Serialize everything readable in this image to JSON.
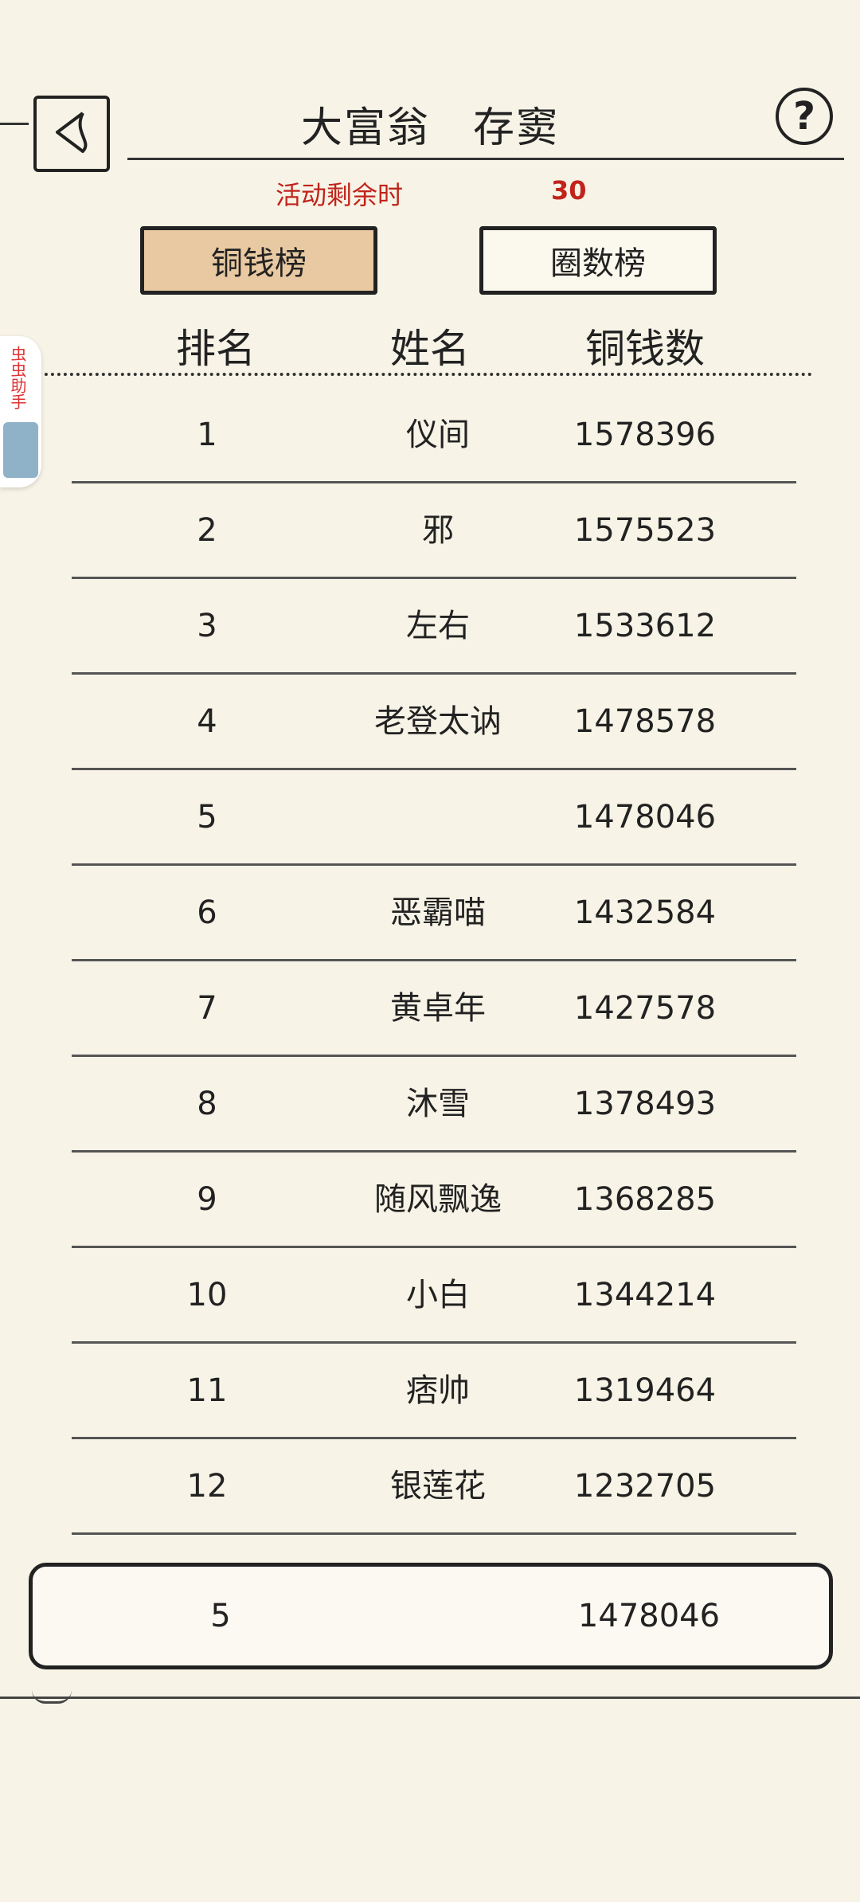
{
  "header": {
    "title": "大富翁　存窦",
    "help_label": "?"
  },
  "countdown": {
    "label": "活动剩余时",
    "value": "30"
  },
  "tabs": [
    {
      "label": "铜钱榜",
      "active": true
    },
    {
      "label": "圈数榜",
      "active": false
    }
  ],
  "columns": {
    "rank": "排名",
    "name": "姓名",
    "coins": "铜钱数"
  },
  "rows": [
    {
      "rank": "1",
      "name": "仪间",
      "coins": "1578396"
    },
    {
      "rank": "2",
      "name": "邪",
      "coins": "1575523"
    },
    {
      "rank": "3",
      "name": "左右",
      "coins": "1533612"
    },
    {
      "rank": "4",
      "name": "老登太讷",
      "coins": "1478578"
    },
    {
      "rank": "5",
      "name": "",
      "coins": "1478046"
    },
    {
      "rank": "6",
      "name": "恶霸喵",
      "coins": "1432584"
    },
    {
      "rank": "7",
      "name": "黄卓年",
      "coins": "1427578"
    },
    {
      "rank": "8",
      "name": "沐雪",
      "coins": "1378493"
    },
    {
      "rank": "9",
      "name": "随风飘逸",
      "coins": "1368285"
    },
    {
      "rank": "10",
      "name": "小白",
      "coins": "1344214"
    },
    {
      "rank": "11",
      "name": "痞帅",
      "coins": "1319464"
    },
    {
      "rank": "12",
      "name": "银莲花",
      "coins": "1232705"
    }
  ],
  "my_rank": {
    "rank": "5",
    "name": "",
    "coins": "1478046"
  },
  "side_helper": {
    "label": "虫虫助手"
  }
}
